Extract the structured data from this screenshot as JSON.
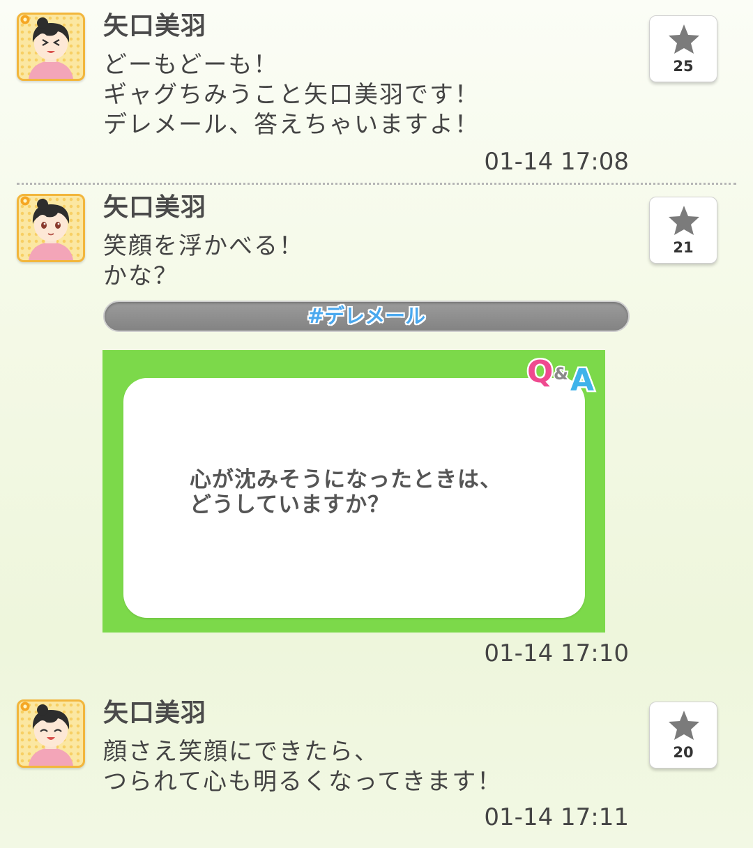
{
  "posts": [
    {
      "author": "矢口美羽",
      "lines": [
        "どーもどーも！",
        "ギャグちみうこと矢口美羽です！",
        "デレメール、答えちゃいますよ！"
      ],
      "time": "01-14 17:08",
      "likes": "25"
    },
    {
      "author": "矢口美羽",
      "lines": [
        "笑顔を浮かべる！",
        "かな？"
      ],
      "hashtag": "#デレメール",
      "qa": {
        "badge": "Q&A",
        "question_lines": [
          "心が沈みそうになったときは、",
          "どうしていますか？"
        ]
      },
      "time": "01-14 17:10",
      "likes": "21"
    },
    {
      "author": "矢口美羽",
      "lines": [
        "顔さえ笑顔にできたら、",
        "つられて心も明るくなってきます！"
      ],
      "time": "01-14 17:11",
      "likes": "20"
    }
  ],
  "icons": {
    "like": "star-icon",
    "avatar_badge": "flower-icon"
  },
  "colors": {
    "qa_frame": "#7cd94a",
    "avatar_frame": "#f2b63c",
    "hashtag_text": "#4aa8ee",
    "qa_q": "#ef4a8f",
    "qa_a": "#3fb3ea"
  }
}
